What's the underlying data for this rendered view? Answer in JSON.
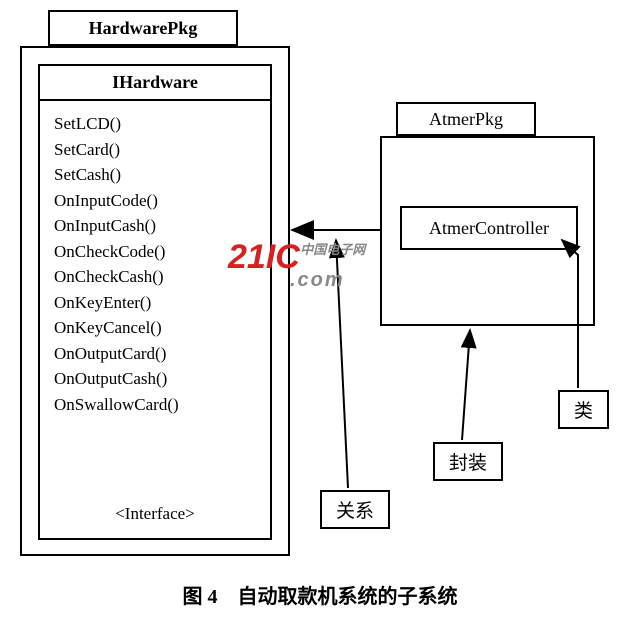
{
  "hardwarePkg": {
    "tab": "HardwarePkg",
    "class": {
      "name": "IHardware",
      "methods": [
        "SetLCD()",
        "SetCard()",
        "SetCash()",
        "OnInputCode()",
        "OnInputCash()",
        "OnCheckCode()",
        "OnCheckCash()",
        "OnKeyEnter()",
        "OnKeyCancel()",
        "OnOutputCard()",
        "OnOutputCash()",
        "OnSwallowCard()"
      ],
      "stereotype": "<Interface>"
    }
  },
  "atmerPkg": {
    "tab": "AtmerPkg",
    "class": {
      "name": "AtmerController"
    }
  },
  "labels": {
    "relation": "关系",
    "package": "封装",
    "classLbl": "类"
  },
  "watermark": {
    "main": "21IC",
    "sub1": "中国电子网",
    "sub2": ".com"
  },
  "caption": "图 4　自动取款机系统的子系统"
}
